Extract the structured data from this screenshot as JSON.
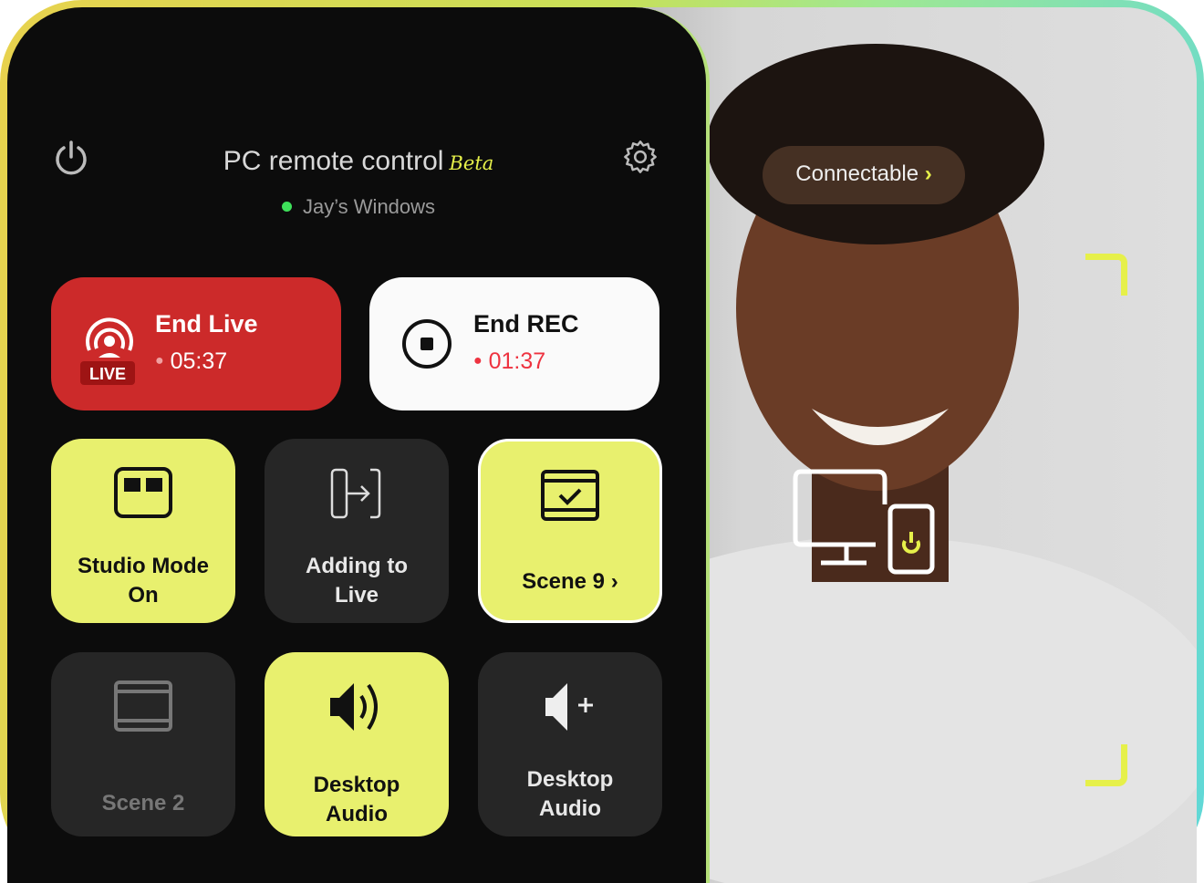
{
  "header": {
    "title": "PC remote control",
    "beta": "Beta",
    "device": "Jay’s Windows",
    "status_color": "#3ee05a"
  },
  "live": {
    "title": "End Live",
    "time": "05:37",
    "badge": "LIVE",
    "color": "#cc2a2a"
  },
  "rec": {
    "title": "End REC",
    "time": "01:37",
    "dot_color": "#ee3340"
  },
  "tiles": [
    {
      "label": "Studio Mode On",
      "icon": "studio-mode-icon",
      "active": true
    },
    {
      "label": "Adding to Live",
      "icon": "add-to-live-icon",
      "active": false
    },
    {
      "label": "Scene 9",
      "icon": "scene-check-icon",
      "active": true
    },
    {
      "label": "Scene 2",
      "icon": "scene-icon",
      "active": false
    },
    {
      "label": "Desktop Audio",
      "icon": "speaker-icon",
      "active": true
    },
    {
      "label": "Desktop Audio",
      "icon": "speaker-add-icon",
      "active": false
    }
  ],
  "photo": {
    "pill": "Connectable",
    "accent": "#e6f04a"
  }
}
